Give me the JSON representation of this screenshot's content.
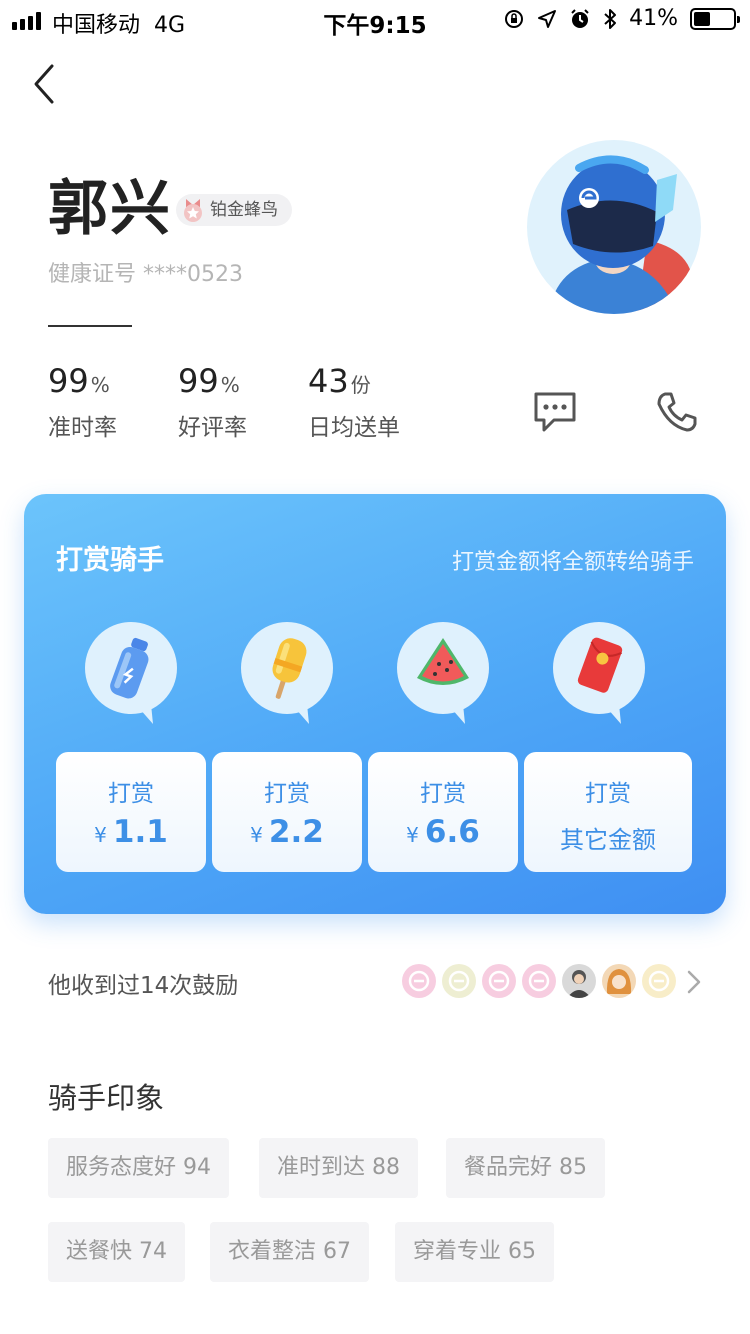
{
  "status_bar": {
    "carrier": "中国移动",
    "network": "4G",
    "time": "下午9:15",
    "battery": "41%",
    "battery_level": 0.41
  },
  "rider": {
    "name": "郭兴",
    "rank": "铂金蜂鸟",
    "health_cert": "健康证号 ****0523"
  },
  "stats": [
    {
      "value": "99",
      "unit": "%",
      "label": "准时率"
    },
    {
      "value": "99",
      "unit": "%",
      "label": "好评率"
    },
    {
      "value": "43",
      "unit": "份",
      "label": "日均送单"
    }
  ],
  "tip": {
    "title": "打赏骑手",
    "subtitle": "打赏金额将全额转给骑手",
    "gifts": [
      "water-bottle-icon",
      "popsicle-icon",
      "watermelon-icon",
      "red-envelope-icon"
    ],
    "buttons": [
      {
        "label": "打赏",
        "currency": "¥",
        "amount": "1.1"
      },
      {
        "label": "打赏",
        "currency": "¥",
        "amount": "2.2"
      },
      {
        "label": "打赏",
        "currency": "¥",
        "amount": "6.6"
      },
      {
        "label": "打赏",
        "other": "其它金额"
      }
    ]
  },
  "encouragement": {
    "text": "他收到过14次鼓励"
  },
  "impressions": {
    "title": "骑手印象",
    "tags": [
      {
        "label": "服务态度好 94"
      },
      {
        "label": "准时到达 88"
      },
      {
        "label": "餐品完好 85"
      },
      {
        "label": "送餐快 74"
      },
      {
        "label": "衣着整洁 67"
      },
      {
        "label": "穿着专业 65"
      }
    ]
  },
  "colors": {
    "card_gradient_start": "#6cc4fb",
    "card_gradient_end": "#3f8ff2",
    "button_text": "#3d8fe6",
    "tag_bg": "#f4f4f6"
  }
}
